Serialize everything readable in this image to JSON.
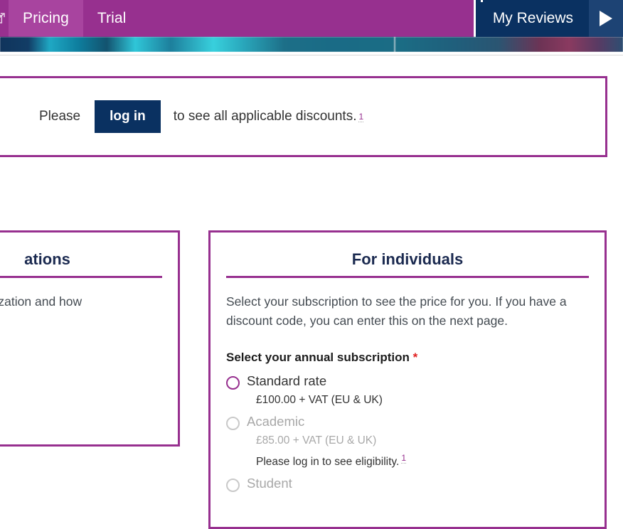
{
  "nav": {
    "ext_icon": "external-link-icon",
    "items": [
      {
        "label": "Pricing",
        "active": true
      },
      {
        "label": "Trial",
        "active": false
      }
    ],
    "my_reviews_label": "My Reviews",
    "toggle_icon": "play-triangle-icon",
    "colors": {
      "purple": "#97308f",
      "purple_active": "#a8449f",
      "navy": "#0a3161",
      "navy_light": "#1d4374"
    }
  },
  "login_banner": {
    "lead_text": "Please",
    "button_label": "log in",
    "trail_text": "to see all applicable discounts.",
    "footnote_marker": "1",
    "border_color": "#97308f"
  },
  "panel_organizations": {
    "title": "ations",
    "paragraph_1": "pe of organization and how",
    "paragraph_2": "."
  },
  "panel_individuals": {
    "title": "For individuals",
    "intro": "Select your subscription to see the price for you. If you have a discount code, you can enter this on the next page.",
    "subscription_heading": "Select your annual subscription",
    "required_marker": "*",
    "options": [
      {
        "label": "Standard rate",
        "price": "£100.00 + VAT (EU & UK)",
        "note": "",
        "disabled": false,
        "selected": false
      },
      {
        "label": "Academic",
        "price": "£85.00 + VAT (EU & UK)",
        "note": "Please log in to see eligibility.",
        "note_footnote": "1",
        "disabled": true,
        "selected": false
      },
      {
        "label": "Student",
        "price": "",
        "note": "",
        "disabled": true,
        "selected": false
      }
    ]
  }
}
